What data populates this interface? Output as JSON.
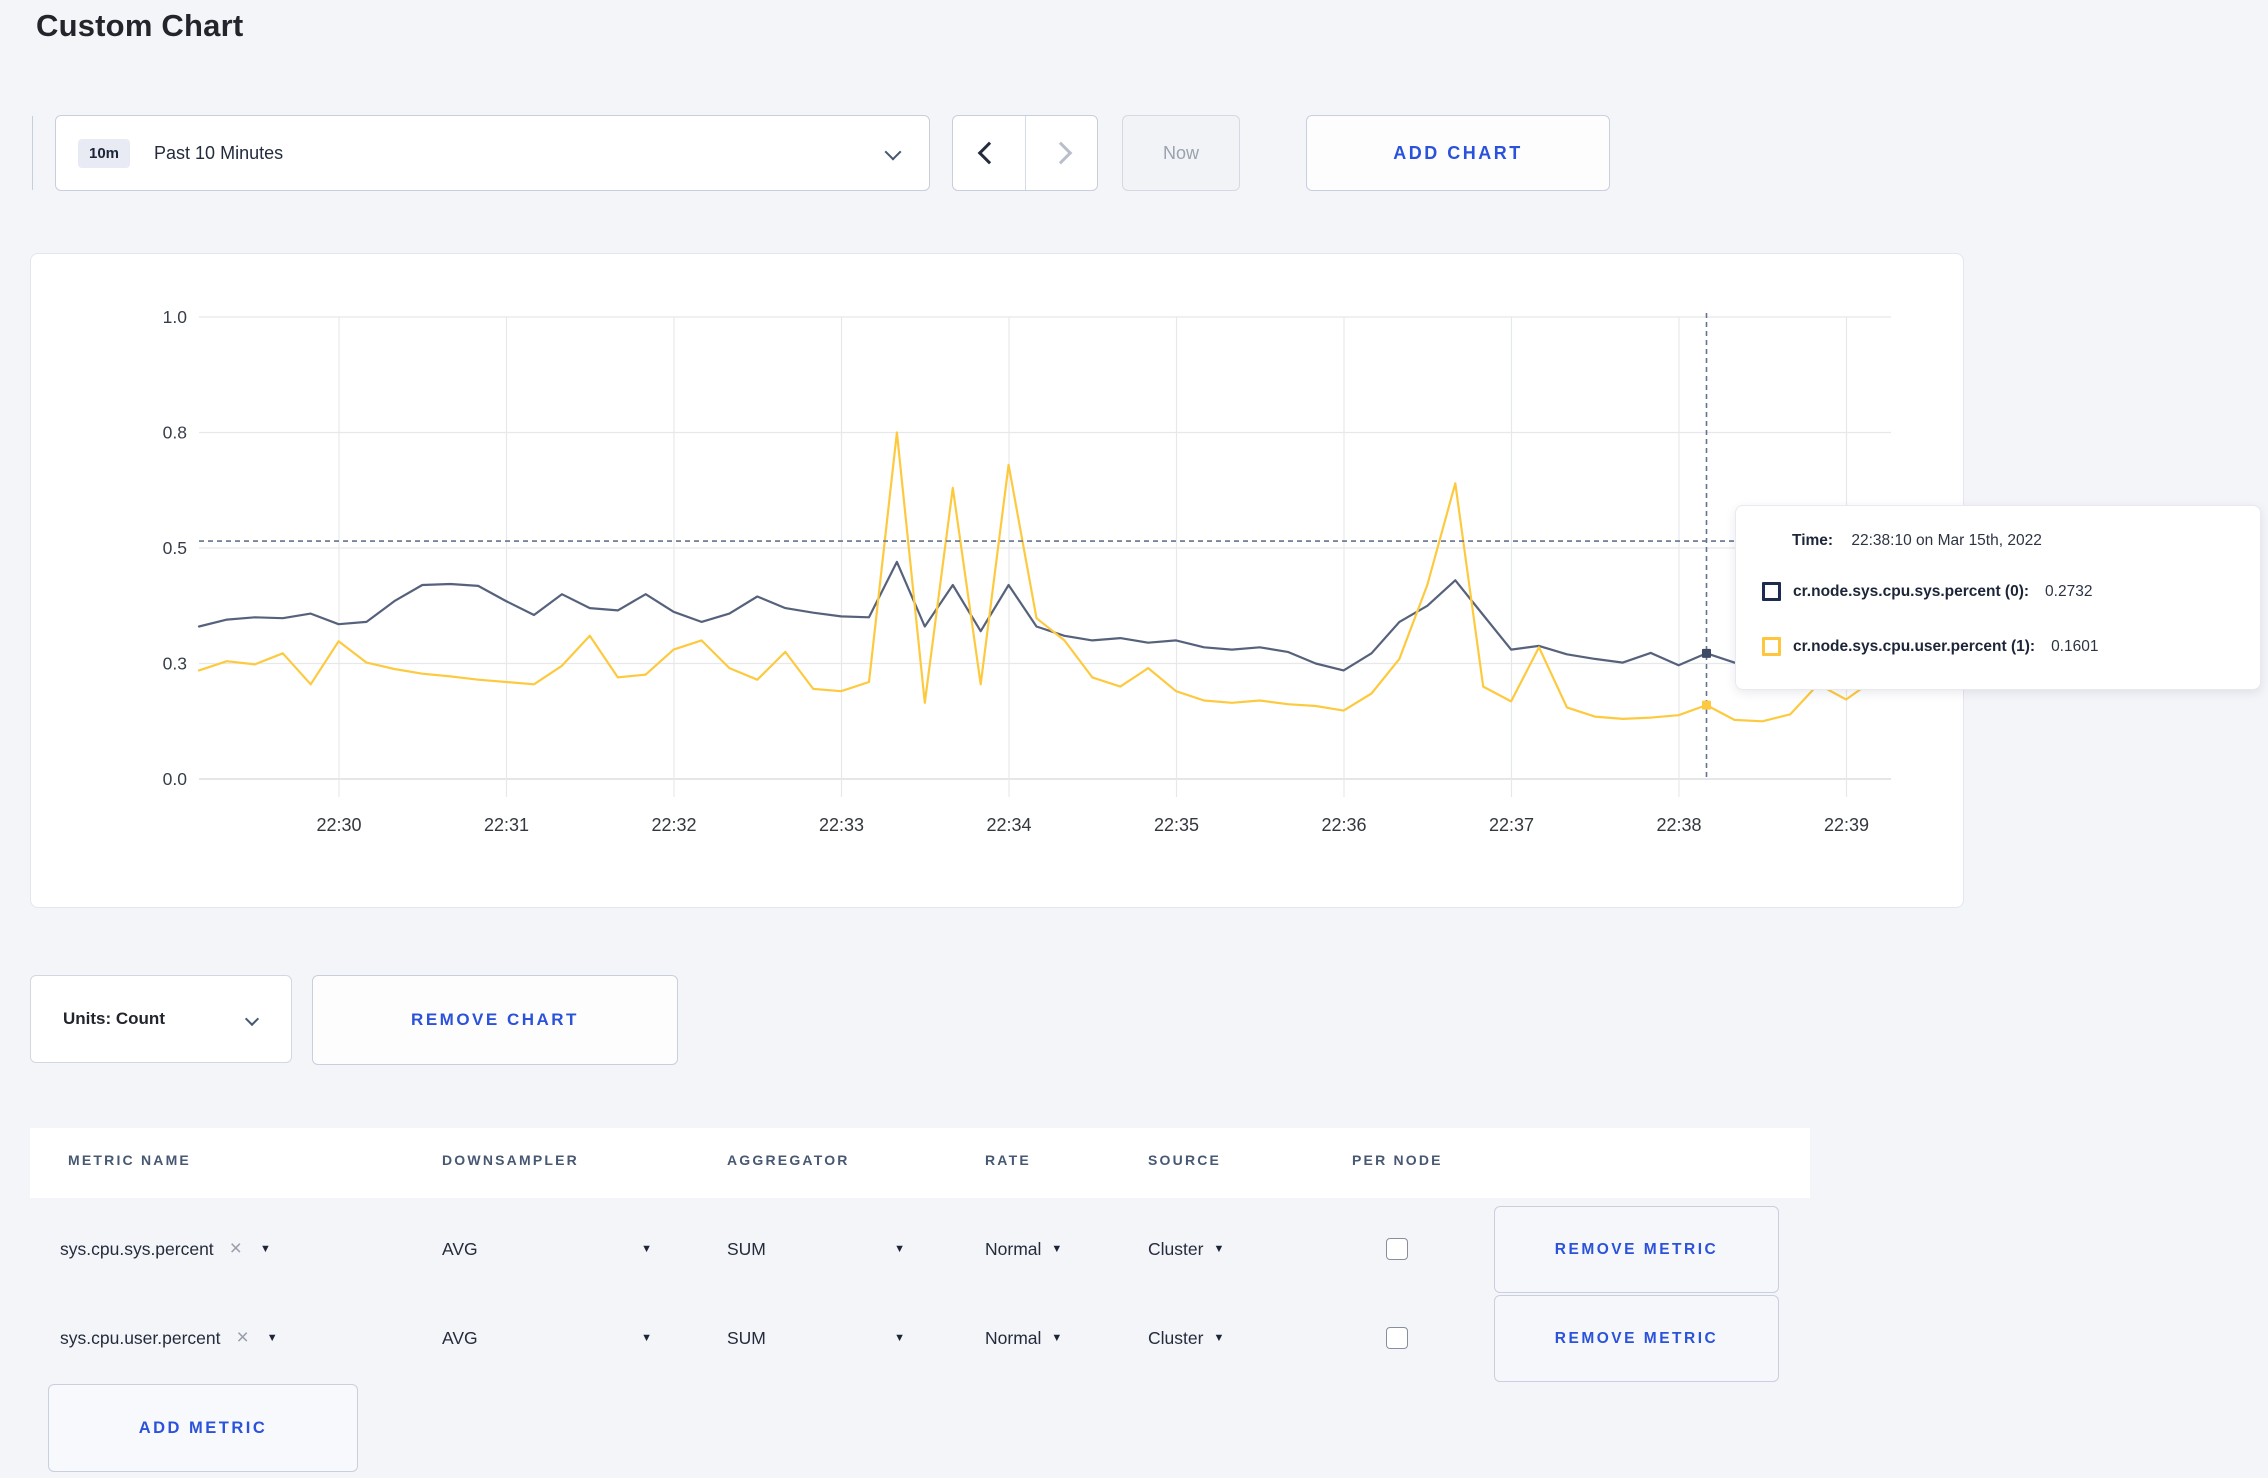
{
  "page": {
    "title": "Custom Chart"
  },
  "toolbar": {
    "time_badge": "10m",
    "time_label": "Past 10 Minutes",
    "now_label": "Now",
    "add_chart_label": "ADD CHART"
  },
  "tooltip": {
    "time_label": "Time:",
    "time_value": "22:38:10 on Mar 15th, 2022",
    "rows": [
      {
        "label": "cr.node.sys.cpu.sys.percent (0):",
        "value": "0.2732",
        "color": "#1c2c4f"
      },
      {
        "label": "cr.node.sys.cpu.user.percent (1):",
        "value": "0.1601",
        "color": "#ffc53d"
      }
    ]
  },
  "chart_controls": {
    "units_label": "Units: Count",
    "remove_chart_label": "REMOVE CHART"
  },
  "metrics_table": {
    "headers": [
      "METRIC NAME",
      "DOWNSAMPLER",
      "AGGREGATOR",
      "RATE",
      "SOURCE",
      "PER NODE"
    ],
    "rows": [
      {
        "metric": "sys.cpu.sys.percent",
        "remove_symbol": "×",
        "downsampler": "AVG",
        "aggregator": "SUM",
        "rate": "Normal",
        "source": "Cluster",
        "per_node_checked": false,
        "remove_label": "REMOVE METRIC"
      },
      {
        "metric": "sys.cpu.user.percent",
        "remove_symbol": "×",
        "downsampler": "AVG",
        "aggregator": "SUM",
        "rate": "Normal",
        "source": "Cluster",
        "per_node_checked": false,
        "remove_label": "REMOVE METRIC"
      }
    ],
    "add_metric_label": "ADD METRIC"
  },
  "chart_data": {
    "type": "line",
    "title": "",
    "xlabel": "",
    "ylabel": "",
    "ylim": [
      0,
      1
    ],
    "grid": true,
    "x_start": "22:29:10",
    "x_end": "22:39:10",
    "interval_seconds": 10,
    "x_tick_labels": [
      "22:30",
      "22:31",
      "22:32",
      "22:33",
      "22:34",
      "22:35",
      "22:36",
      "22:37",
      "22:38",
      "22:39"
    ],
    "y_ticks": [
      0,
      0.25,
      0.5,
      0.75,
      1.0
    ],
    "y_tick_labels": [
      "0.0",
      "0.3",
      "0.5",
      "0.8",
      "1.0"
    ],
    "series": [
      {
        "name": "cr.node.sys.cpu.sys.percent",
        "color": "#56627c",
        "values": [
          0.33,
          0.345,
          0.35,
          0.348,
          0.358,
          0.335,
          0.34,
          0.385,
          0.42,
          0.422,
          0.418,
          0.385,
          0.355,
          0.4,
          0.37,
          0.365,
          0.4,
          0.362,
          0.34,
          0.358,
          0.395,
          0.37,
          0.36,
          0.352,
          0.35,
          0.47,
          0.33,
          0.42,
          0.32,
          0.42,
          0.33,
          0.31,
          0.3,
          0.305,
          0.295,
          0.3,
          0.285,
          0.28,
          0.285,
          0.275,
          0.25,
          0.235,
          0.272,
          0.34,
          0.375,
          0.43,
          0.355,
          0.28,
          0.288,
          0.27,
          0.26,
          0.252,
          0.273,
          0.246,
          0.272,
          0.252,
          0.258,
          0.255,
          0.26,
          0.265,
          0.262
        ]
      },
      {
        "name": "cr.node.sys.cpu.user.percent",
        "color": "#fdca3f",
        "values": [
          0.235,
          0.255,
          0.248,
          0.272,
          0.205,
          0.298,
          0.252,
          0.238,
          0.228,
          0.222,
          0.215,
          0.21,
          0.205,
          0.245,
          0.31,
          0.22,
          0.226,
          0.28,
          0.3,
          0.24,
          0.215,
          0.275,
          0.195,
          0.19,
          0.21,
          0.75,
          0.165,
          0.63,
          0.205,
          0.68,
          0.348,
          0.3,
          0.22,
          0.2,
          0.24,
          0.19,
          0.17,
          0.165,
          0.17,
          0.162,
          0.158,
          0.148,
          0.185,
          0.26,
          0.42,
          0.64,
          0.2,
          0.168,
          0.285,
          0.155,
          0.135,
          0.13,
          0.133,
          0.138,
          0.16,
          0.128,
          0.125,
          0.14,
          0.205,
          0.172,
          0.215
        ]
      }
    ],
    "crosshair": {
      "x_index": 54,
      "x_time": "22:38:10",
      "y_value": 0.515
    },
    "legend_position": "tooltip"
  }
}
